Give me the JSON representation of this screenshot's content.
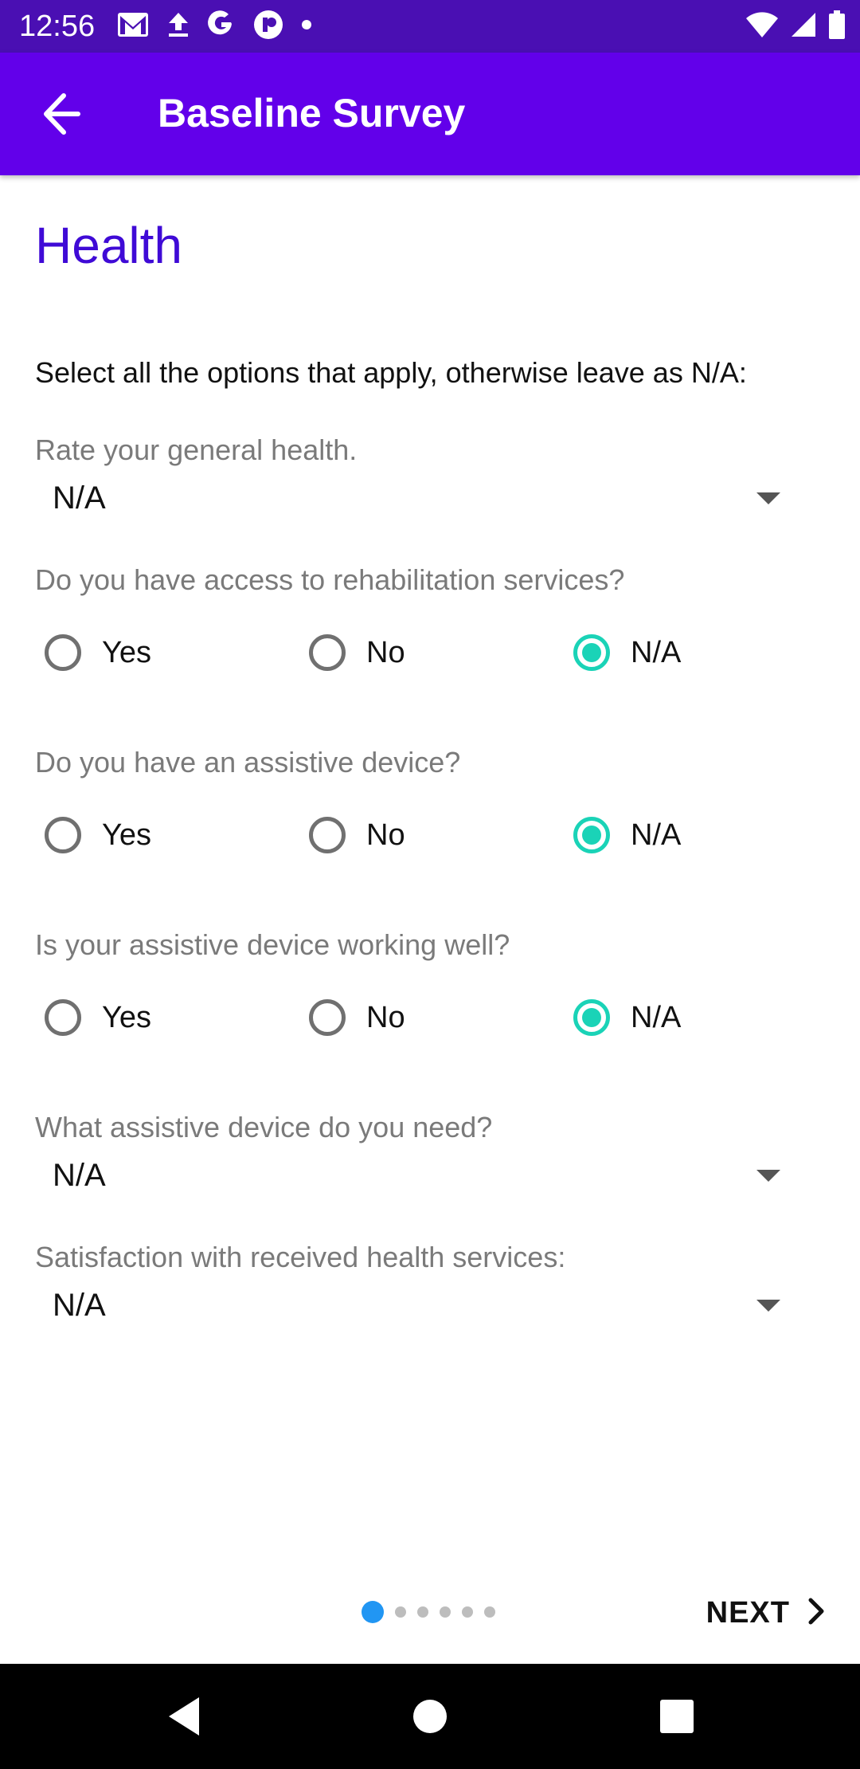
{
  "status_bar": {
    "time": "12:56",
    "left_icons": [
      "gmail-icon",
      "upload-icon",
      "google-icon",
      "app-icon",
      "dot-icon"
    ],
    "right_icons": [
      "wifi-icon",
      "signal-icon",
      "battery-icon"
    ]
  },
  "app_bar": {
    "title": "Baseline Survey",
    "back_icon": "arrow-back-icon"
  },
  "section": {
    "title": "Health",
    "instructions": "Select all the options that apply, otherwise leave as N/A:"
  },
  "questions": {
    "general_health": {
      "label": "Rate your general health.",
      "value": "N/A"
    },
    "rehab_access": {
      "label": "Do you have access to rehabilitation services?",
      "options": [
        "Yes",
        "No",
        "N/A"
      ],
      "selected": "N/A"
    },
    "assistive_device": {
      "label": "Do you have an assistive device?",
      "options": [
        "Yes",
        "No",
        "N/A"
      ],
      "selected": "N/A"
    },
    "device_working": {
      "label": "Is your assistive device working well?",
      "options": [
        "Yes",
        "No",
        "N/A"
      ],
      "selected": "N/A"
    },
    "device_needed": {
      "label": "What assistive device do you need?",
      "value": "N/A"
    },
    "satisfaction": {
      "label": "Satisfaction with received health services:",
      "value": "N/A"
    }
  },
  "pager": {
    "total_pages": 6,
    "current_page": 1
  },
  "footer": {
    "next_label": "NEXT"
  },
  "colors": {
    "status_bar": "#4a0fb3",
    "app_bar": "#6200ea",
    "section_title": "#3f0ad6",
    "radio_checked": "#1ad3b7",
    "pager_active": "#2196f3"
  }
}
